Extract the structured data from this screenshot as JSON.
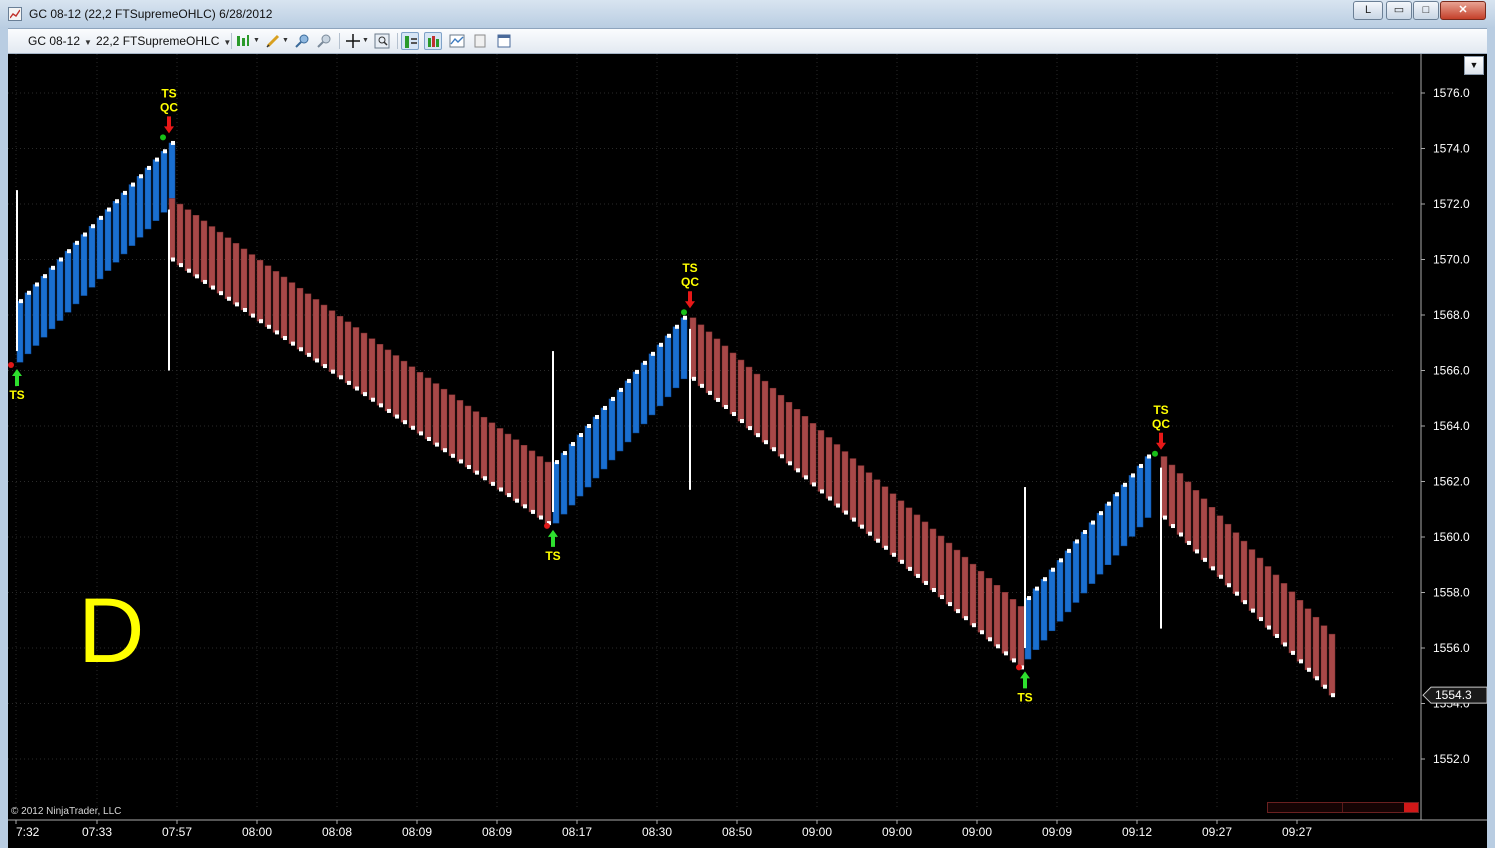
{
  "window": {
    "title": "GC 08-12 (22,2 FTSupremeOHLC)  6/28/2012",
    "buttons": {
      "layout": "L",
      "minimize": "▭",
      "maximize": "□",
      "close": "✕"
    }
  },
  "toolbar": {
    "instrument": "GC 08-12",
    "bar_type": "22,2 FTSupremeOHLC"
  },
  "chart_data": {
    "type": "candlestick",
    "instrument": "GC 08-12",
    "bar_type": "22,2 FTSupremeOHLC",
    "date": "6/28/2012",
    "ylim": [
      1550.5,
      1577.5
    ],
    "y_ticks": [
      1552.0,
      1554.0,
      1556.0,
      1558.0,
      1560.0,
      1562.0,
      1564.0,
      1566.0,
      1568.0,
      1570.0,
      1572.0,
      1574.0,
      1576.0
    ],
    "x_tick_labels": [
      "7:32",
      "07:33",
      "07:57",
      "08:00",
      "08:08",
      "08:09",
      "08:09",
      "08:17",
      "08:30",
      "08:50",
      "09:00",
      "09:00",
      "09:00",
      "09:09",
      "09:12",
      "09:27",
      "09:27"
    ],
    "grid": true,
    "last_price": "1554.3",
    "copyright": "© 2012 NinjaTrader, LLC",
    "watermark": "D",
    "segments": [
      {
        "direction": "up",
        "bars": 20,
        "start": 1568.5,
        "end": 1574.2
      },
      {
        "direction": "down",
        "bars": 48,
        "start": 1570.0,
        "end": 1560.5
      },
      {
        "direction": "up",
        "bars": 17,
        "start": 1562.7,
        "end": 1567.9
      },
      {
        "direction": "down",
        "bars": 42,
        "start": 1565.7,
        "end": 1555.3
      },
      {
        "direction": "up",
        "bars": 16,
        "start": 1557.8,
        "end": 1562.9
      },
      {
        "direction": "down",
        "bars": 22,
        "start": 1560.7,
        "end": 1554.3
      }
    ],
    "signals": [
      {
        "type": "entry",
        "side": "long",
        "labels": [
          "TS"
        ],
        "price": 1566.2
      },
      {
        "type": "entry",
        "side": "short",
        "labels": [
          "TS",
          "QC"
        ],
        "price": 1574.4
      },
      {
        "type": "entry",
        "side": "long",
        "labels": [
          "TS"
        ],
        "price": 1560.4
      },
      {
        "type": "entry",
        "side": "short",
        "labels": [
          "TS",
          "QC"
        ],
        "price": 1568.1
      },
      {
        "type": "entry",
        "side": "long",
        "labels": [
          "TS"
        ],
        "price": 1555.3
      },
      {
        "type": "entry",
        "side": "short",
        "labels": [
          "TS",
          "QC"
        ],
        "price": 1563.0
      }
    ],
    "colors": {
      "up_bar": "#1a6fd0",
      "down_bar": "#a84848",
      "long_arrow": "#2ee02e",
      "short_arrow": "#e81818",
      "signal_text": "#ffff00",
      "grid": "#2a2a2a",
      "axis_text": "#ffffff",
      "watermark": "#ffff00"
    }
  }
}
